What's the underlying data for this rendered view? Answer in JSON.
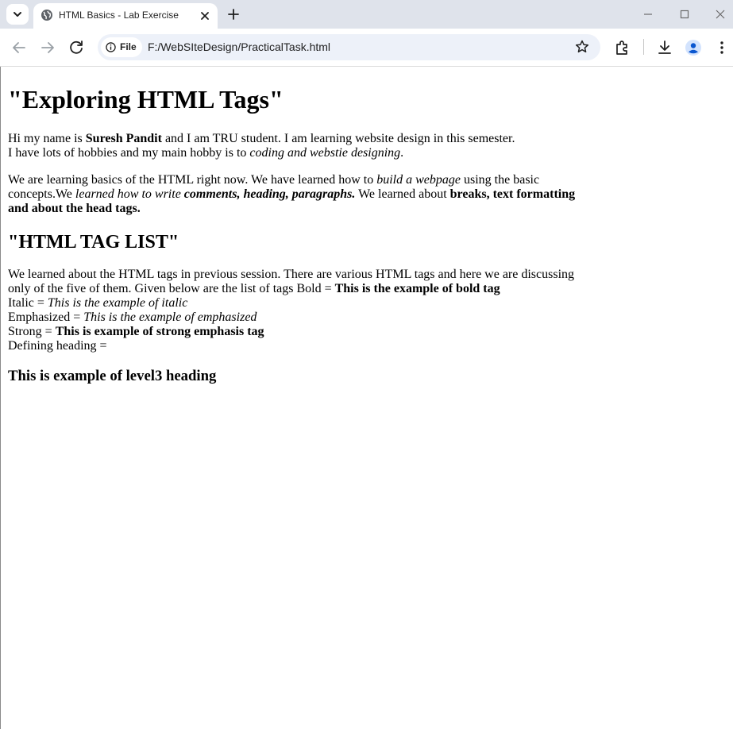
{
  "browser": {
    "tab_title": "HTML Basics - Lab Exercise",
    "address_chip_label": "File",
    "url": "F:/WebSIteDesign/PracticalTask.html",
    "icons": [
      "tab-search-icon",
      "globe-icon",
      "close-icon",
      "plus-icon",
      "minimize-icon",
      "maximize-icon",
      "window-close-icon",
      "back-icon",
      "forward-icon",
      "reload-icon",
      "info-icon",
      "star-icon",
      "extensions-icon",
      "download-icon",
      "profile-icon",
      "menu-icon"
    ]
  },
  "page": {
    "title": "\"Exploring HTML Tags\"",
    "intro": {
      "t1": "Hi my name is ",
      "name": "Suresh Pandit",
      "t2": " and I am TRU student. I am learning website design in this semester.",
      "t3": "I have lots of hobbies and my main hobby is to ",
      "hobby": "coding and webstie designing",
      "t4": "."
    },
    "learning": {
      "t1": "We are learning basics of the HTML right now. We have learned how to ",
      "em1": "build a webpage",
      "t2": " using the basic concepts.We ",
      "em2": "learned how to write ",
      "bi": "comments, heading, paragraphs.",
      "t3": " We learned about ",
      "b1": "breaks, text formatting and about the head tags."
    },
    "section_title": "\"HTML TAG LIST\"",
    "tags": {
      "intro": "We learned about the HTML tags in previous session. There are various HTML tags and here we are discussing only of the five of them. Given below are the list of tags Bold = ",
      "bold_example": "This is the example of bold tag",
      "italic_label": "Italic = ",
      "italic_example": "This is the example of italic",
      "em_label": "Emphasized = ",
      "em_example": "This is the example of emphasized",
      "strong_label": "Strong = ",
      "strong_example": "This is example of strong emphasis tag",
      "heading_label": "Defining heading ="
    },
    "level3_heading": "This is example of level3 heading"
  }
}
